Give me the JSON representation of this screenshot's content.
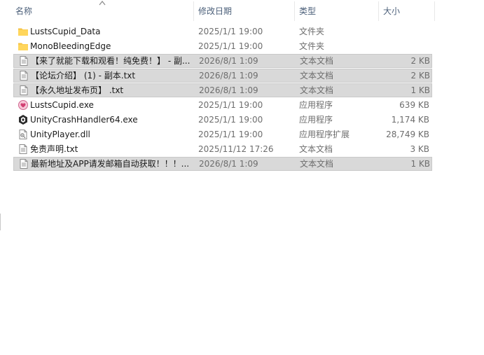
{
  "columns": {
    "name": "名称",
    "date": "修改日期",
    "type": "类型",
    "size": "大小"
  },
  "files": [
    {
      "name": "LustsCupid_Data",
      "date": "2025/1/1 19:00",
      "type": "文件夹",
      "size": "",
      "icon": "folder-icon",
      "selected": false
    },
    {
      "name": "MonoBleedingEdge",
      "date": "2025/1/1 19:00",
      "type": "文件夹",
      "size": "",
      "icon": "folder-icon",
      "selected": false
    },
    {
      "name": "【来了就能下载和观看！纯免费！】 - 副...",
      "date": "2026/8/1 1:09",
      "type": "文本文档",
      "size": "2 KB",
      "icon": "text-file-icon",
      "selected": true
    },
    {
      "name": "【论坛介绍】 (1) - 副本.txt",
      "date": "2026/8/1 1:09",
      "type": "文本文档",
      "size": "2 KB",
      "icon": "text-file-icon",
      "selected": true
    },
    {
      "name": "【永久地址发布页】 .txt",
      "date": "2026/8/1 1:09",
      "type": "文本文档",
      "size": "1 KB",
      "icon": "text-file-icon",
      "selected": true
    },
    {
      "name": "LustsCupid.exe",
      "date": "2025/1/1 19:00",
      "type": "应用程序",
      "size": "639 KB",
      "icon": "app-exe-icon",
      "selected": false
    },
    {
      "name": "UnityCrashHandler64.exe",
      "date": "2025/1/1 19:00",
      "type": "应用程序",
      "size": "1,174 KB",
      "icon": "unity-icon",
      "selected": false
    },
    {
      "name": "UnityPlayer.dll",
      "date": "2025/1/1 19:00",
      "type": "应用程序扩展",
      "size": "28,749 KB",
      "icon": "dll-file-icon",
      "selected": false
    },
    {
      "name": "免责声明.txt",
      "date": "2025/11/12 17:26",
      "type": "文本文档",
      "size": "3 KB",
      "icon": "text-file-icon",
      "selected": false
    },
    {
      "name": "最新地址及APP请发邮箱自动获取！！！...",
      "date": "2026/8/1 1:09",
      "type": "文本文档",
      "size": "1 KB",
      "icon": "text-file-icon",
      "selected": true
    }
  ]
}
